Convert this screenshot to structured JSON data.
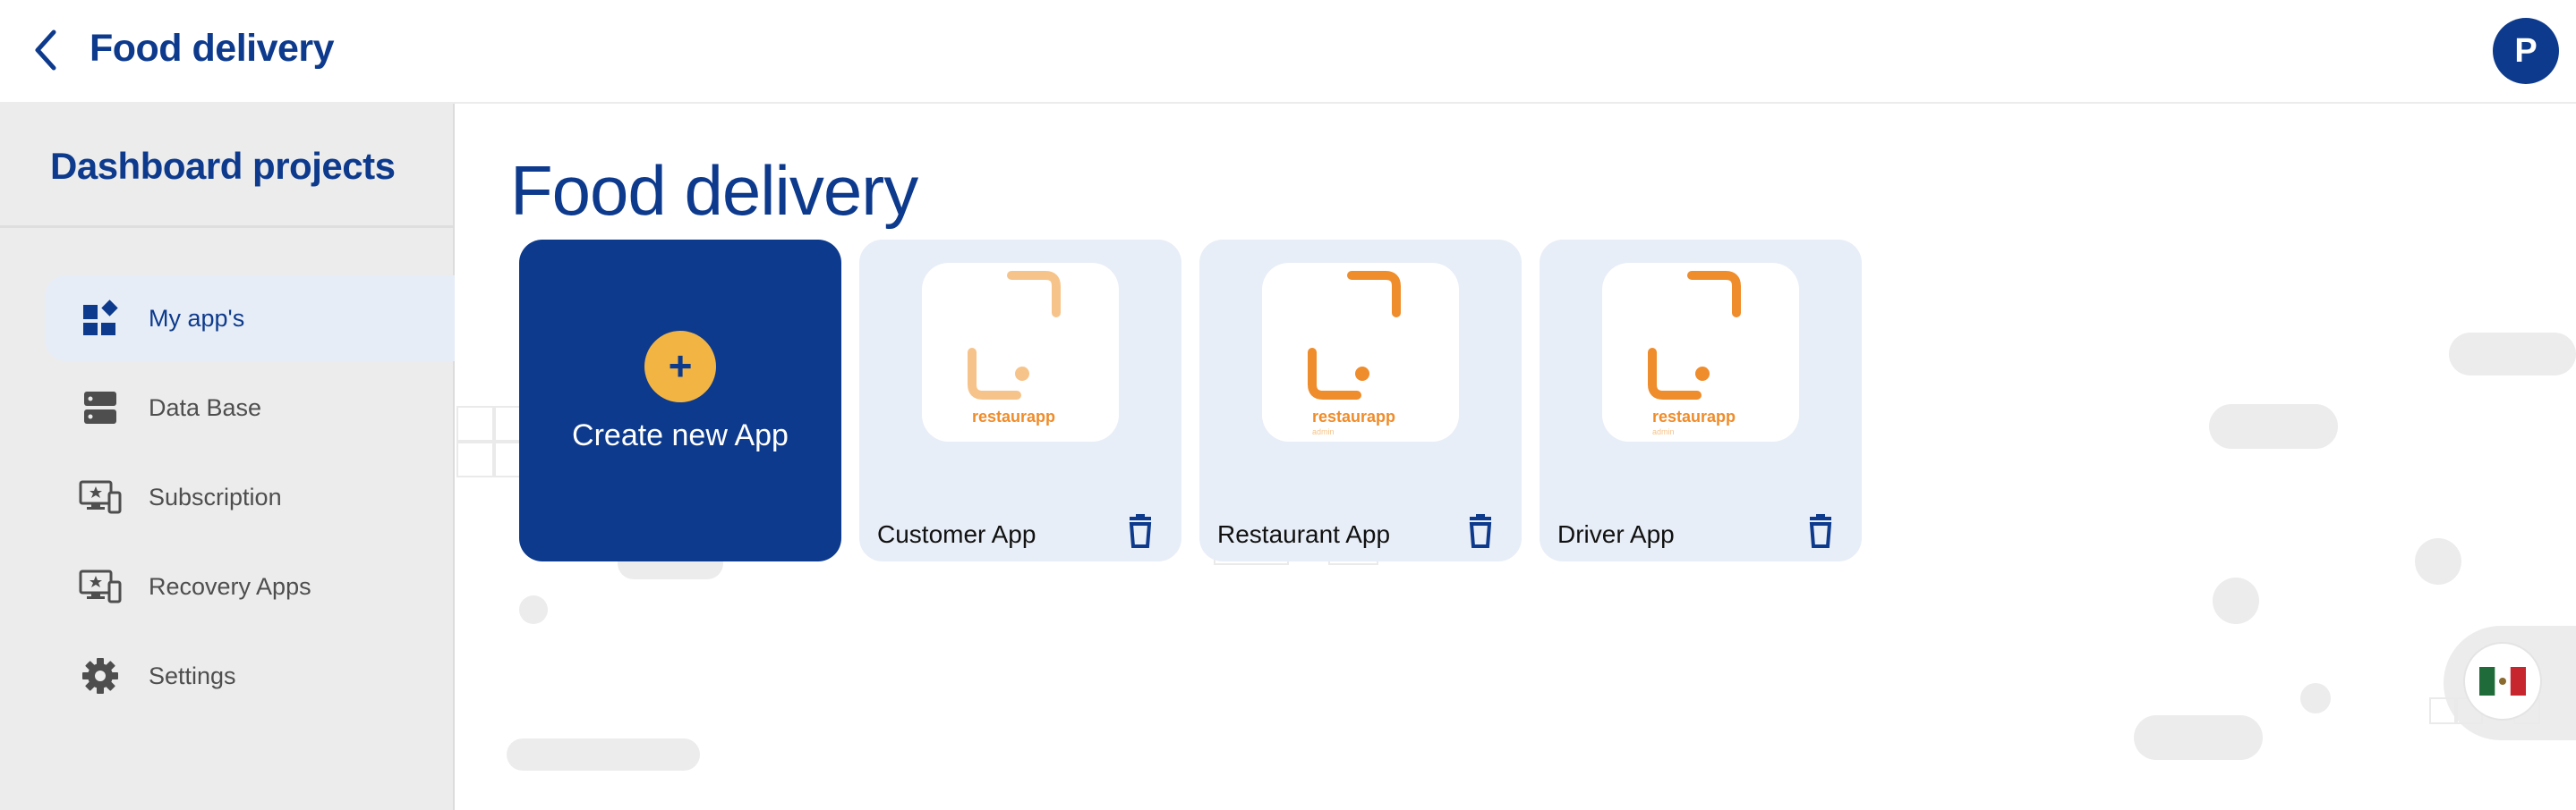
{
  "header": {
    "title": "Food delivery",
    "avatar_initial": "P",
    "icons": {
      "back": "chevron-left-icon"
    }
  },
  "sidebar": {
    "title": "Dashboard projects",
    "items": [
      {
        "label": "My app's",
        "icon": "dashboard-grid-icon",
        "active": true
      },
      {
        "label": "Data Base",
        "icon": "database-icon",
        "active": false
      },
      {
        "label": "Subscription",
        "icon": "monitor-star-icon",
        "active": false
      },
      {
        "label": "Recovery Apps",
        "icon": "monitor-star-icon",
        "active": false
      },
      {
        "label": "Settings",
        "icon": "gear-icon",
        "active": false
      }
    ]
  },
  "main": {
    "title": "Food delivery",
    "create_label": "Create new App",
    "create_symbol": "+",
    "apps": [
      {
        "name": "Customer App",
        "logo_text": "restaurapp",
        "logo_sub": "",
        "tone": "light"
      },
      {
        "name": "Restaurant App",
        "logo_text": "restaurapp",
        "logo_sub": "admin",
        "tone": "dark"
      },
      {
        "name": "Driver App",
        "logo_text": "restaurapp",
        "logo_sub": "admin",
        "tone": "dark"
      }
    ]
  },
  "language": {
    "icon": "mexico-flag-icon"
  },
  "colors": {
    "brand_blue": "#0d3a8c",
    "accent_yellow": "#f2b544",
    "logo_orange": "#ef8c2b",
    "logo_orange_light": "#f6c48a",
    "card_bg": "#e8eef7",
    "sidebar_bg": "#ececec"
  }
}
